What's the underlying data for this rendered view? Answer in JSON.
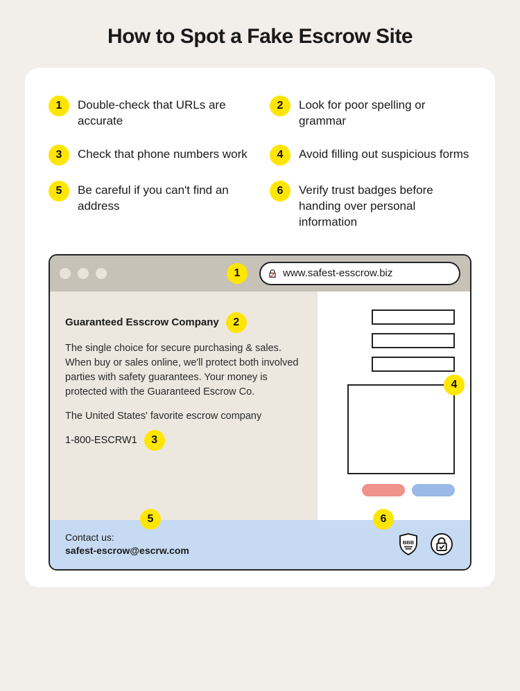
{
  "title": "How to Spot a Fake Escrow Site",
  "tips": [
    {
      "n": "1",
      "text": "Double-check that URLs are accurate"
    },
    {
      "n": "2",
      "text": "Look for poor spelling or grammar"
    },
    {
      "n": "3",
      "text": "Check that phone numbers work"
    },
    {
      "n": "4",
      "text": "Avoid filling out suspicious forms"
    },
    {
      "n": "5",
      "text": "Be careful if you can't find an address"
    },
    {
      "n": "6",
      "text": "Verify trust badges before handing over personal information"
    }
  ],
  "mockup": {
    "url": "www.safest-esscrow.biz",
    "company": "Guaranteed Esscrow Company",
    "body": "The single choice for secure purchasing & sales. When buy or sales online, we'll protect both involved parties with safety guarantees. Your money is protected with the Guaranteed Escrow Co.",
    "tagline": "The United States' favorite escrow company",
    "phone": "1-800-ESCRW1",
    "contact_label": "Contact us:",
    "contact_email": "safest-escrow@escrw.com"
  },
  "markers": {
    "m1": "1",
    "m2": "2",
    "m3": "3",
    "m4": "4",
    "m5": "5",
    "m6": "6"
  }
}
